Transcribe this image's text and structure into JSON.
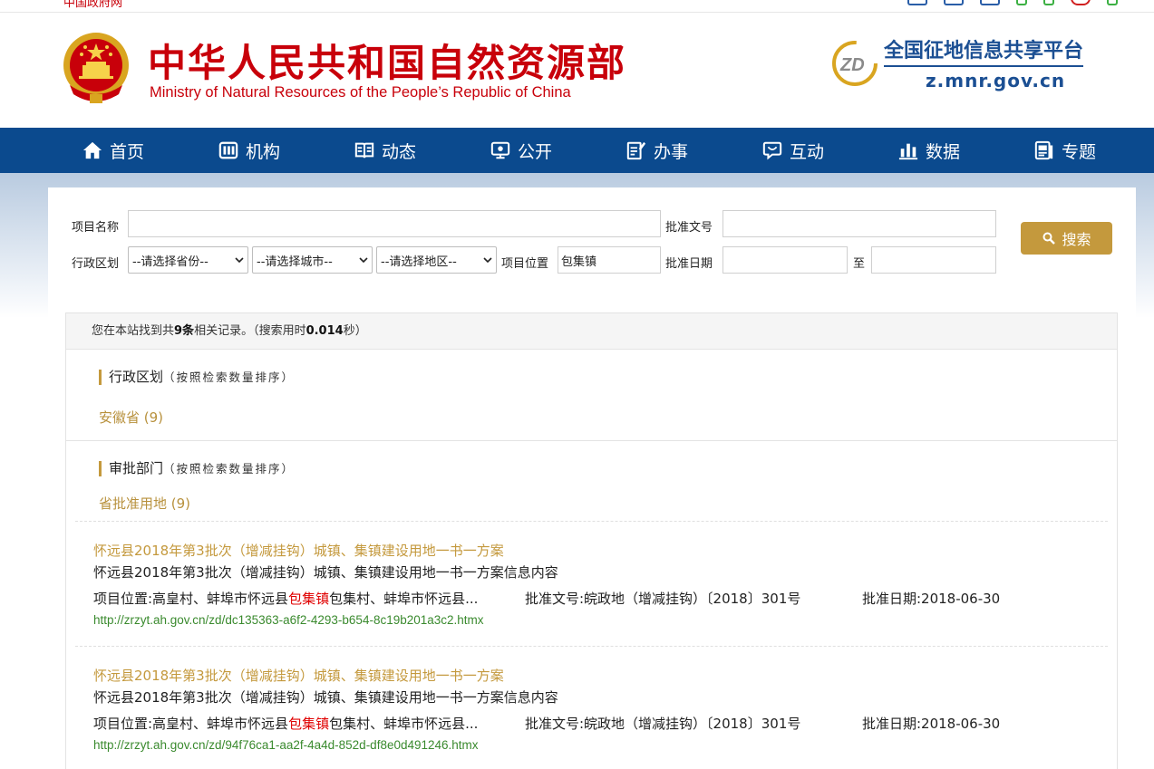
{
  "topbar": {
    "gov_link": "中国政府网"
  },
  "header": {
    "ministry_cn": "中华人民共和国自然资源部",
    "ministry_en": "Ministry of Natural Resources of the People’s Republic of China",
    "platform_name": "全国征地信息共享平台",
    "platform_url": "z.mnr.gov.cn",
    "zd_text": "ZD"
  },
  "nav": [
    {
      "label": "首页",
      "icon": "home-icon"
    },
    {
      "label": "机构",
      "icon": "org-icon"
    },
    {
      "label": "动态",
      "icon": "news-icon"
    },
    {
      "label": "公开",
      "icon": "monitor-icon"
    },
    {
      "label": "办事",
      "icon": "edit-icon"
    },
    {
      "label": "互动",
      "icon": "chat-icon"
    },
    {
      "label": "数据",
      "icon": "bar-chart-icon"
    },
    {
      "label": "专题",
      "icon": "topic-icon"
    }
  ],
  "form": {
    "project_name_label": "项目名称",
    "project_name_value": "",
    "approval_no_label": "批准文号",
    "approval_no_value": "",
    "region_label": "行政区划",
    "province_select": "--请选择省份--",
    "city_select": "--请选择城市--",
    "district_select": "--请选择地区--",
    "location_label": "项目位置",
    "location_value": "包集镇",
    "approval_date_label": "批准日期",
    "date_from": "",
    "date_to_label": "至",
    "date_to": "",
    "search_label": "搜索"
  },
  "summary": {
    "prefix": "您在本站找到共",
    "count": "9条",
    "middle": "相关记录。（搜索用时",
    "time": "0.014",
    "suffix": "秒）"
  },
  "facets": [
    {
      "title": "行政区划",
      "hint": "（按照检索数量排序）",
      "item": "安徽省 (9)"
    },
    {
      "title": "审批部门",
      "hint": "（按照检索数量排序）",
      "item": "省批准用地 (9)"
    }
  ],
  "results": [
    {
      "title": "怀远县2018年第3批次（增减挂钩）城镇、集镇建设用地一书一方案",
      "desc": "怀远县2018年第3批次（增减挂钩）城镇、集镇建设用地一书一方案信息内容",
      "loc_prefix": "项目位置:高皇村、蚌埠市怀远县",
      "loc_hl": "包集镇",
      "loc_suffix": "包集村、蚌埠市怀远县...",
      "approval_no": "批准文号:皖政地（增减挂钩）〔2018〕301号",
      "approval_date": "批准日期:2018-06-30",
      "url": "http://zrzyt.ah.gov.cn/zd/dc135363-a6f2-4293-b654-8c19b201a3c2.htmx"
    },
    {
      "title": "怀远县2018年第3批次（增减挂钩）城镇、集镇建设用地一书一方案",
      "desc": "怀远县2018年第3批次（增减挂钩）城镇、集镇建设用地一书一方案信息内容",
      "loc_prefix": "项目位置:高皇村、蚌埠市怀远县",
      "loc_hl": "包集镇",
      "loc_suffix": "包集村、蚌埠市怀远县...",
      "approval_no": "批准文号:皖政地（增减挂钩）〔2018〕301号",
      "approval_date": "批准日期:2018-06-30",
      "url": "http://zrzyt.ah.gov.cn/zd/94f76ca1-aa2f-4a4d-852d-df8e0d491246.htmx"
    }
  ],
  "colors": {
    "brand_red": "#c8000a",
    "nav_blue": "#0b4a8e",
    "gold": "#c4993d",
    "url_green": "#3a8a2e"
  }
}
